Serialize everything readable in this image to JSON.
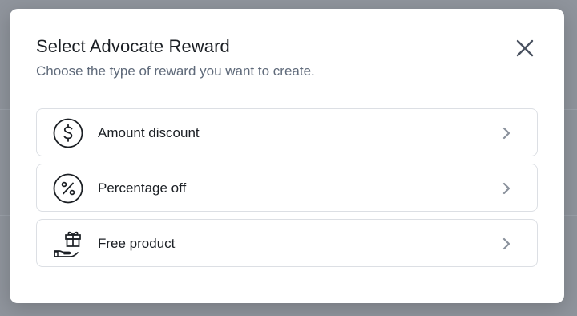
{
  "modal": {
    "title": "Select Advocate Reward",
    "subtitle": "Choose the type of reward you want to create.",
    "close_icon": "close-icon"
  },
  "options": [
    {
      "label": "Amount discount",
      "icon": "dollar-circle-icon"
    },
    {
      "label": "Percentage off",
      "icon": "percent-circle-icon"
    },
    {
      "label": "Free product",
      "icon": "gift-hand-icon"
    }
  ],
  "colors": {
    "backdrop": "#8f949c",
    "modal_bg": "#ffffff",
    "title": "#1b1f24",
    "subtitle": "#5f6a7a",
    "border": "#dcdfe4",
    "chevron": "#8a919c"
  }
}
